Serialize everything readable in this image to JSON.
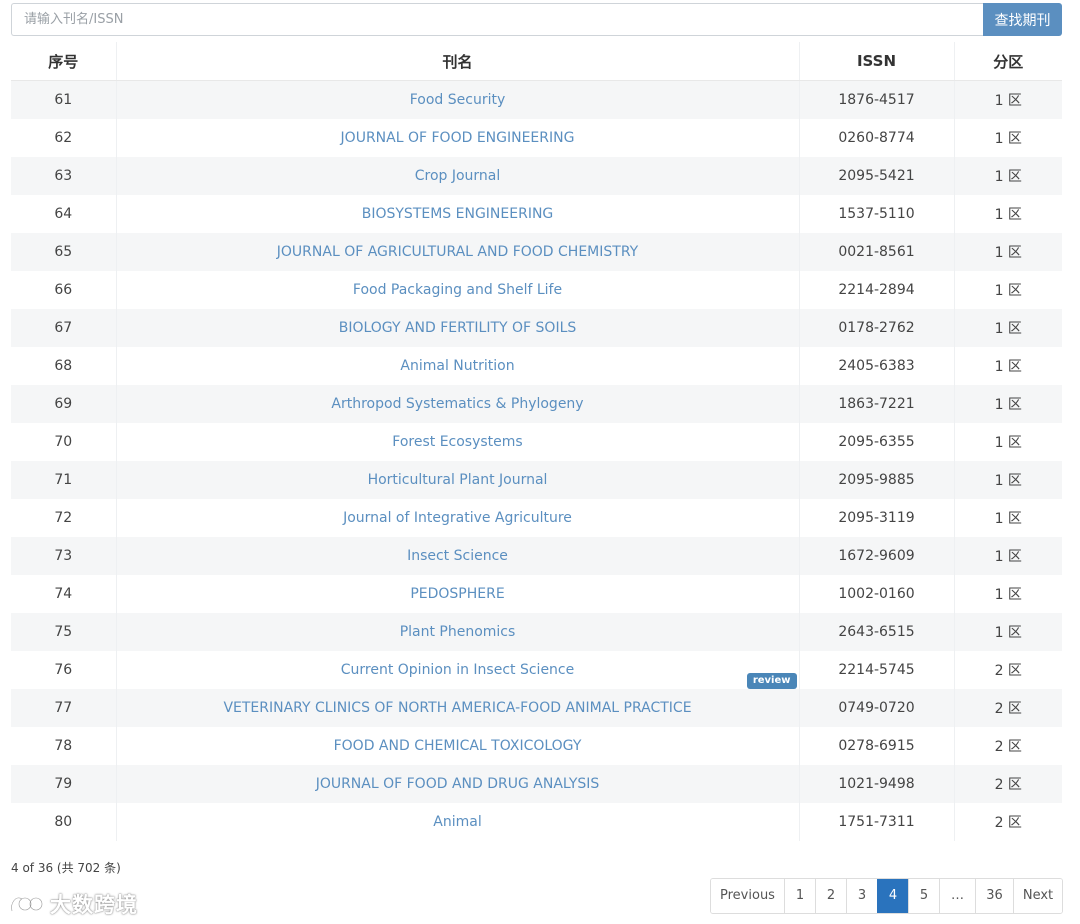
{
  "search": {
    "placeholder": "请输入刊名/ISSN",
    "button_label": "查找期刊"
  },
  "table": {
    "headers": {
      "no": "序号",
      "name": "刊名",
      "issn": "ISSN",
      "zone": "分区"
    },
    "rows": [
      {
        "no": "61",
        "name": "Food Security",
        "issn": "1876-4517",
        "zone": "1 区"
      },
      {
        "no": "62",
        "name": "JOURNAL OF FOOD ENGINEERING",
        "issn": "0260-8774",
        "zone": "1 区"
      },
      {
        "no": "63",
        "name": "Crop Journal",
        "issn": "2095-5421",
        "zone": "1 区"
      },
      {
        "no": "64",
        "name": "BIOSYSTEMS ENGINEERING",
        "issn": "1537-5110",
        "zone": "1 区"
      },
      {
        "no": "65",
        "name": "JOURNAL OF AGRICULTURAL AND FOOD CHEMISTRY",
        "issn": "0021-8561",
        "zone": "1 区"
      },
      {
        "no": "66",
        "name": "Food Packaging and Shelf Life",
        "issn": "2214-2894",
        "zone": "1 区"
      },
      {
        "no": "67",
        "name": "BIOLOGY AND FERTILITY OF SOILS",
        "issn": "0178-2762",
        "zone": "1 区"
      },
      {
        "no": "68",
        "name": "Animal Nutrition",
        "issn": "2405-6383",
        "zone": "1 区"
      },
      {
        "no": "69",
        "name": "Arthropod Systematics & Phylogeny",
        "issn": "1863-7221",
        "zone": "1 区"
      },
      {
        "no": "70",
        "name": "Forest Ecosystems",
        "issn": "2095-6355",
        "zone": "1 区"
      },
      {
        "no": "71",
        "name": "Horticultural Plant Journal",
        "issn": "2095-9885",
        "zone": "1 区"
      },
      {
        "no": "72",
        "name": "Journal of Integrative Agriculture",
        "issn": "2095-3119",
        "zone": "1 区"
      },
      {
        "no": "73",
        "name": "Insect Science",
        "issn": "1672-9609",
        "zone": "1 区"
      },
      {
        "no": "74",
        "name": "PEDOSPHERE",
        "issn": "1002-0160",
        "zone": "1 区"
      },
      {
        "no": "75",
        "name": "Plant Phenomics",
        "issn": "2643-6515",
        "zone": "1 区"
      },
      {
        "no": "76",
        "name": "Current Opinion in Insect Science",
        "issn": "2214-5745",
        "zone": "2 区",
        "badge": "review"
      },
      {
        "no": "77",
        "name": "VETERINARY CLINICS OF NORTH AMERICA-FOOD ANIMAL PRACTICE",
        "issn": "0749-0720",
        "zone": "2 区"
      },
      {
        "no": "78",
        "name": "FOOD AND CHEMICAL TOXICOLOGY",
        "issn": "0278-6915",
        "zone": "2 区"
      },
      {
        "no": "79",
        "name": "JOURNAL OF FOOD AND DRUG ANALYSIS",
        "issn": "1021-9498",
        "zone": "2 区"
      },
      {
        "no": "80",
        "name": "Animal",
        "issn": "1751-7311",
        "zone": "2 区"
      }
    ]
  },
  "record_info": "4 of 36 (共 702 条)",
  "watermark": "大数跨境",
  "pagination": {
    "items": [
      {
        "label": "Previous",
        "w": 73
      },
      {
        "label": "1",
        "w": 31
      },
      {
        "label": "2",
        "w": 31
      },
      {
        "label": "3",
        "w": 31
      },
      {
        "label": "4",
        "w": 31,
        "active": true
      },
      {
        "label": "5",
        "w": 31
      },
      {
        "label": "…",
        "w": 36,
        "ellipsis": true
      },
      {
        "label": "36",
        "w": 38
      },
      {
        "label": "Next",
        "w": 49
      }
    ]
  },
  "colors": {
    "link": "#5b8fc0",
    "accent": "#2a73bd",
    "search_button": "#5b8fc0",
    "badge": "#4a86b8"
  }
}
